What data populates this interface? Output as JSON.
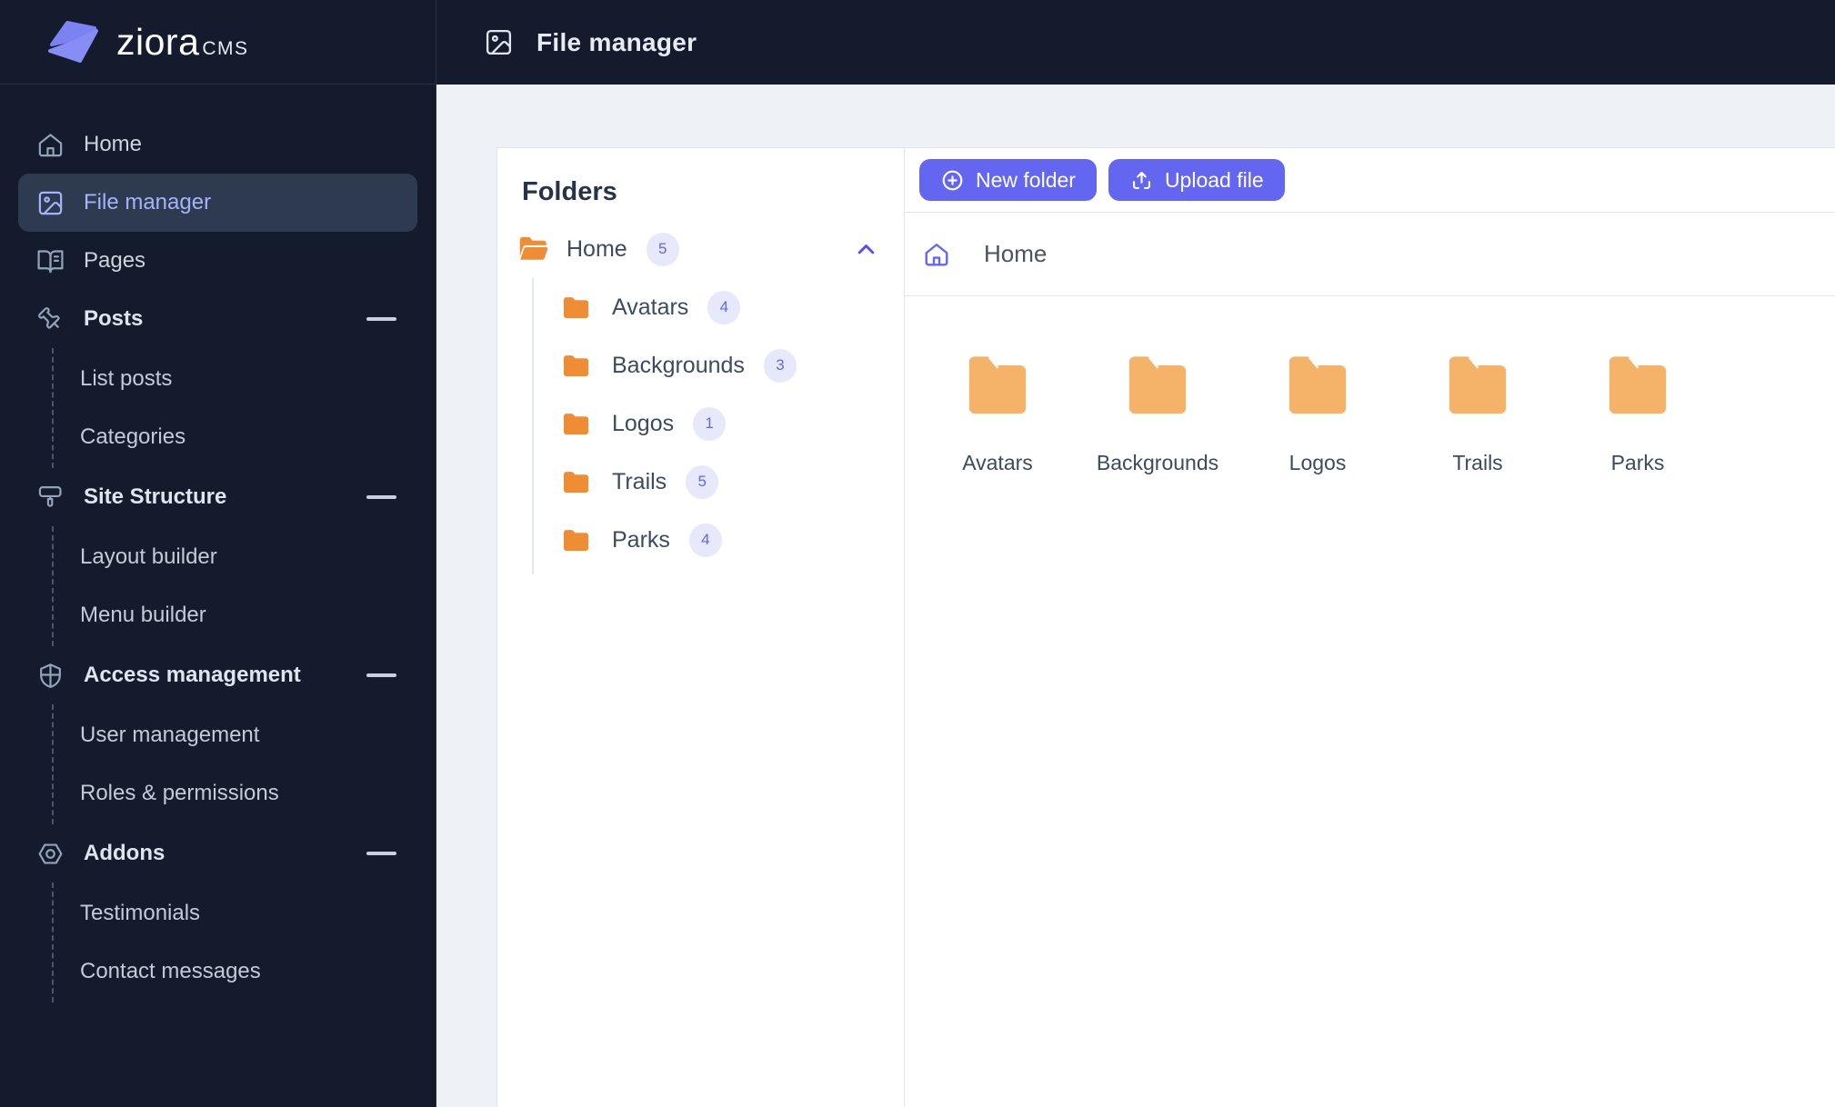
{
  "brand": {
    "name": "ziora",
    "suffix": "CMS"
  },
  "header": {
    "title": "File manager"
  },
  "sidebar": {
    "items": [
      {
        "label": "Home"
      },
      {
        "label": "File manager",
        "selected": true
      },
      {
        "label": "Pages"
      },
      {
        "label": "Posts"
      },
      {
        "label": "List posts"
      },
      {
        "label": "Categories"
      },
      {
        "label": "Site Structure"
      },
      {
        "label": "Layout builder"
      },
      {
        "label": "Menu builder"
      },
      {
        "label": "Access management"
      },
      {
        "label": "User management"
      },
      {
        "label": "Roles & permissions"
      },
      {
        "label": "Addons"
      },
      {
        "label": "Testimonials"
      },
      {
        "label": "Contact messages"
      }
    ]
  },
  "folders_panel": {
    "title": "Folders",
    "root": {
      "label": "Home",
      "count": "5"
    },
    "children": [
      {
        "label": "Avatars",
        "count": "4"
      },
      {
        "label": "Backgrounds",
        "count": "3"
      },
      {
        "label": "Logos",
        "count": "1"
      },
      {
        "label": "Trails",
        "count": "5"
      },
      {
        "label": "Parks",
        "count": "4"
      }
    ]
  },
  "toolbar": {
    "new_folder_label": "New folder",
    "upload_file_label": "Upload file"
  },
  "breadcrumb": {
    "current": "Home"
  },
  "file_grid": {
    "items": [
      {
        "name": "Avatars"
      },
      {
        "name": "Backgrounds"
      },
      {
        "name": "Logos"
      },
      {
        "name": "Trails"
      },
      {
        "name": "Parks"
      }
    ]
  },
  "colors": {
    "accent_indigo": "#6366f1",
    "sidebar_bg": "#131b2d",
    "selected_item_bg": "#2d3a50",
    "selected_item_text": "#a8b3f7",
    "folder_orange_small": "#ee8d33",
    "folder_orange_large": "#f5b269",
    "badge_bg": "#e8e8fb",
    "page_bg": "#eef2f6"
  }
}
